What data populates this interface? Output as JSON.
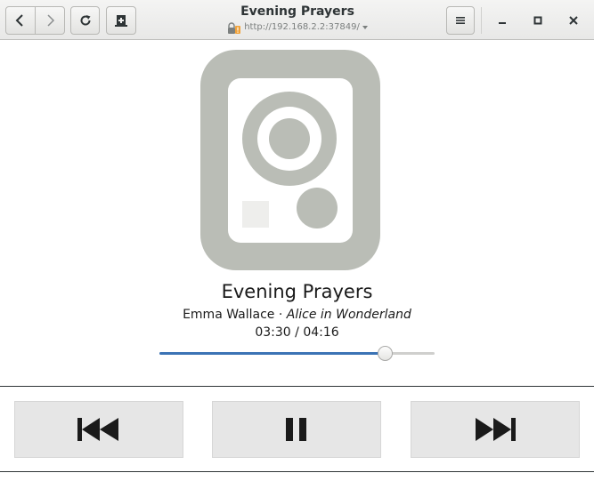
{
  "window": {
    "title": "Evening Prayers",
    "url": "http://192.168.2.2:37849/"
  },
  "icons": {
    "back": "go-back-icon",
    "forward": "go-forward-icon",
    "reload": "reload-icon",
    "new_tab": "new-tab-icon",
    "menu": "hamburger-menu-icon",
    "minimize": "minimize-icon",
    "maximize": "maximize-icon",
    "close": "close-icon",
    "security": "insecure-lock-icon",
    "cover": "audio-speaker-icon",
    "previous": "skip-previous-icon",
    "pause": "pause-icon",
    "next": "skip-next-icon"
  },
  "track": {
    "title": "Evening Prayers",
    "artist": "Emma Wallace",
    "separator": " · ",
    "album": "Alice in Wonderland",
    "elapsed": "03:30",
    "total": "04:16",
    "time_separator": " / ",
    "progress_fraction": 0.8203
  },
  "colors": {
    "accent": "#3b73b5",
    "cover_art": "#babdb6",
    "cover_inner": "#ffffff",
    "cover_square": "#eeeeec",
    "control_bg": "#e6e6e6"
  }
}
